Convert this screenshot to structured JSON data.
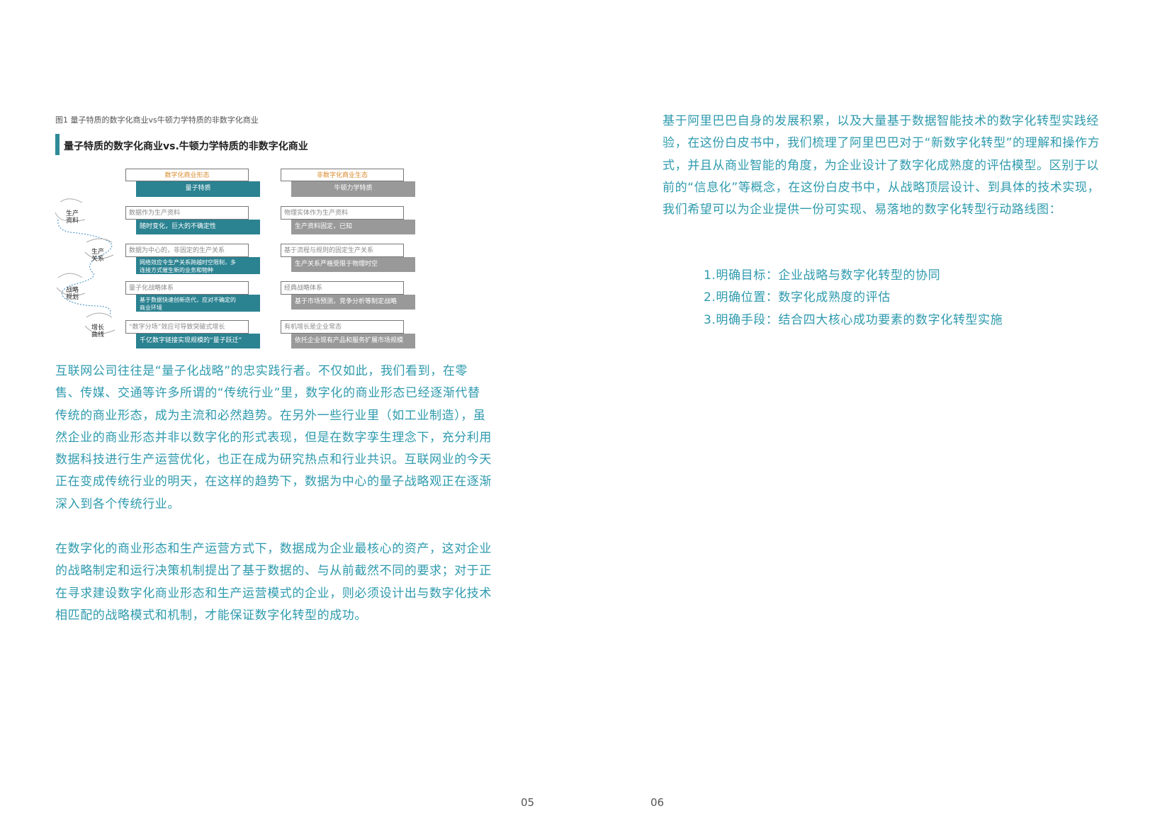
{
  "figure": {
    "caption": "图1 量子特质的数字化商业vs牛顿力学特质的非数字化商业",
    "title": "量子特质的数字化商业vs.牛顿力学特质的非数字化商业",
    "header_digital_top": "数字化商业形态",
    "header_digital_bottom": "量子特质",
    "header_nondigital_top": "非数字化商业生态",
    "header_nondigital_bottom": "牛顿力学特质",
    "rows": [
      {
        "label": "生产\n资料",
        "digital_top": "数据作为生产资料",
        "digital_bottom": "随时变化，巨大的不确定性",
        "nondigital_top": "物理实体作为生产资料",
        "nondigital_bottom": "生产资料固定，已知"
      },
      {
        "label": "生产\n关系",
        "digital_top": "数据为中心的，非固定的生产关系",
        "digital_bottom": "网络效应令生产关系跨越时空限制，多\n连接方式催生新的业务和物种",
        "nondigital_top": "基于流程与规则的固定生产关系",
        "nondigital_bottom": "生产关系严格受限于物理时空"
      },
      {
        "label": "战略\n规划",
        "digital_top": "量子化战略体系",
        "digital_bottom": "基于数据快速创新迭代，应对不确定的\n商业环境",
        "nondigital_top": "经典战略体系",
        "nondigital_bottom": "基于市场预测，竞争分析等制定战略"
      },
      {
        "label": "增长\n曲线",
        "digital_top": "“数字分场”效应可导致突破式增长",
        "digital_bottom": "千亿数字链接实现规模的“量子跃迁”",
        "nondigital_top": "有机增长是企业常态",
        "nondigital_bottom": "依托企业现有产品和服务扩展市场规模"
      }
    ]
  },
  "left_paragraphs": [
    "互联网公司往往是“量子化战略”的忠实践行者。不仅如此，我们看到，在零售、传媒、交通等许多所谓的“传统行业”里，数字化的商业形态已经逐渐代替传统的商业形态，成为主流和必然趋势。在另外一些行业里（如工业制造），虽然企业的商业形态并非以数字化的形式表现，但是在数字孪生理念下，充分利用数据科技进行生产运营优化，也正在成为研究热点和行业共识。互联网业的今天正在变成传统行业的明天，在这样的趋势下，数据为中心的量子战略观正在逐渐深入到各个传统行业。",
    "在数字化的商业形态和生产运营方式下，数据成为企业最核心的资产，这对企业的战略制定和运行决策机制提出了基于数据的、与从前截然不同的要求；对于正在寻求建设数字化商业形态和生产运营模式的企业，则必须设计出与数字化技术相匹配的战略模式和机制，才能保证数字化转型的成功。"
  ],
  "right_paragraph": "基于阿里巴巴自身的发展积累，以及大量基于数据智能技术的数字化转型实践经验，在这份白皮书中，我们梳理了阿里巴巴对于“新数字化转型”的理解和操作方式，并且从商业智能的角度，为企业设计了数字化成熟度的评估模型。区别于以前的“信息化”等概念，在这份白皮书中，从战略顶层设计、到具体的技术实现，我们希望可以为企业提供一份可实现、易落地的数字化转型行动路线图：",
  "list_items": [
    "1.明确目标：企业战略与数字化转型的协同",
    "2.明确位置：数字化成熟度的评估",
    "3.明确手段：结合四大核心成功要素的数字化转型实施"
  ],
  "page_numbers": {
    "left": "05",
    "right": "06"
  }
}
